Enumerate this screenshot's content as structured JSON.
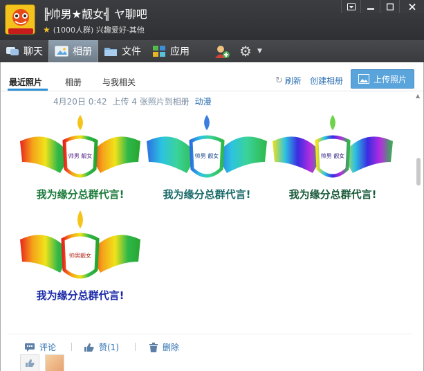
{
  "titlebar": {
    "group_name": "╠帅男★靓女╣ ヤ聊吧",
    "group_desc": "(1000人群) 兴趣爱好-其他",
    "avatar_badge": "1000"
  },
  "tabs": {
    "chat": "聊天",
    "album": "相册",
    "files": "文件",
    "apps": "应用"
  },
  "subtabs": {
    "recent": "最近照片",
    "albums": "相册",
    "related": "与我相关"
  },
  "actions_top": {
    "refresh": "刷新",
    "create_album": "创建相册",
    "upload": "上传照片"
  },
  "post": {
    "time": "4月20日 0:42",
    "text": "上传 4 张照片到相册",
    "album": "动漫",
    "photos": [
      {
        "caption": "我为缘分总群代言!",
        "banner": "帅男 靓女",
        "palette": "rainbow"
      },
      {
        "caption": "我为缘分总群代言!",
        "banner": "帅男 靓女",
        "palette": "cool"
      },
      {
        "caption": "我为缘分总群代言!",
        "banner": "帅男 靓女",
        "palette": "neon"
      },
      {
        "caption": "我为缘分总群代言!",
        "banner": "帅男靓女",
        "palette": "rainbow"
      }
    ]
  },
  "post_actions": {
    "comment": "评论",
    "like": "赞(1)",
    "delete": "删除"
  },
  "colors": {
    "accent": "#2d8fd5",
    "link": "#2c6fb1",
    "upload_bg": "#5aa4dc"
  }
}
